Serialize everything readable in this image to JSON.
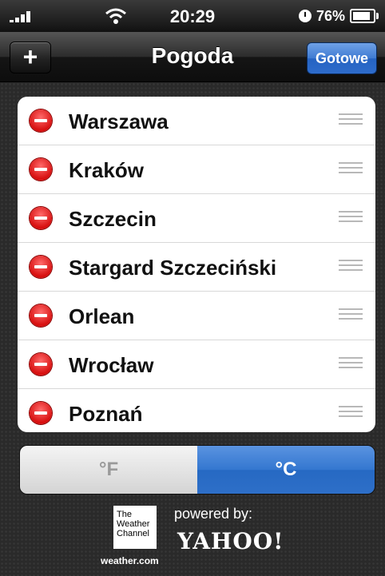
{
  "status_bar": {
    "time": "20:29",
    "battery": "76%"
  },
  "nav": {
    "add_label": "+",
    "title": "Pogoda",
    "done_label": "Gotowe"
  },
  "cities": [
    {
      "name": "Warszawa"
    },
    {
      "name": "Kraków"
    },
    {
      "name": "Szczecin"
    },
    {
      "name": "Stargard Szczeciński"
    },
    {
      "name": "Orlean"
    },
    {
      "name": "Wrocław"
    },
    {
      "name": "Poznań"
    }
  ],
  "units": {
    "fahrenheit": "°F",
    "celsius": "°C",
    "selected": "celsius"
  },
  "footer": {
    "twc_line1": "The",
    "twc_line2": "Weather",
    "twc_line3": "Channel",
    "twc_url": "weather.com",
    "powered_by": "powered by:",
    "yahoo": "YAHOO!"
  },
  "colors": {
    "accent_blue": "#3477d0",
    "delete_red": "#d70f0f"
  }
}
